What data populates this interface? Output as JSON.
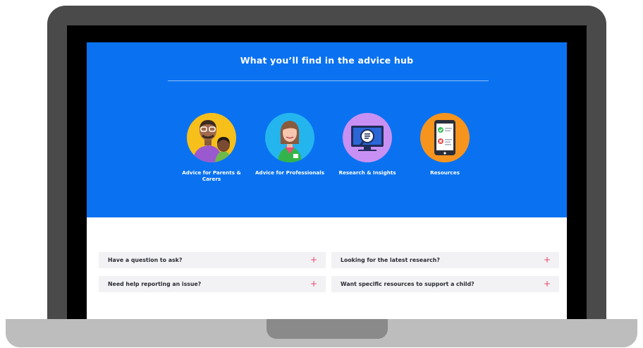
{
  "hero": {
    "title": "What you’ll find in the advice hub"
  },
  "cards": [
    {
      "label": "Advice for Parents & Carers",
      "icon": "parent-child-icon",
      "color": "#f6bf1a"
    },
    {
      "label": "Advice for Professionals",
      "icon": "professional-icon",
      "color": "#24b5ef"
    },
    {
      "label": "Research & Insights",
      "icon": "research-monitor-icon",
      "color": "#c990f4"
    },
    {
      "label": "Resources",
      "icon": "tablet-checklist-icon",
      "color": "#f7941e"
    }
  ],
  "accordion": [
    {
      "question": "Have a question to ask?",
      "toggle": "+"
    },
    {
      "question": "Looking for the latest research?",
      "toggle": "+"
    },
    {
      "question": "Need help reporting an issue?",
      "toggle": "+"
    },
    {
      "question": "Want specific resources to support a child?",
      "toggle": "+"
    }
  ],
  "colors": {
    "hero_background": "#0a72f1",
    "accordion_plus": "#e8456a",
    "accordion_background": "#f2f2f4"
  }
}
